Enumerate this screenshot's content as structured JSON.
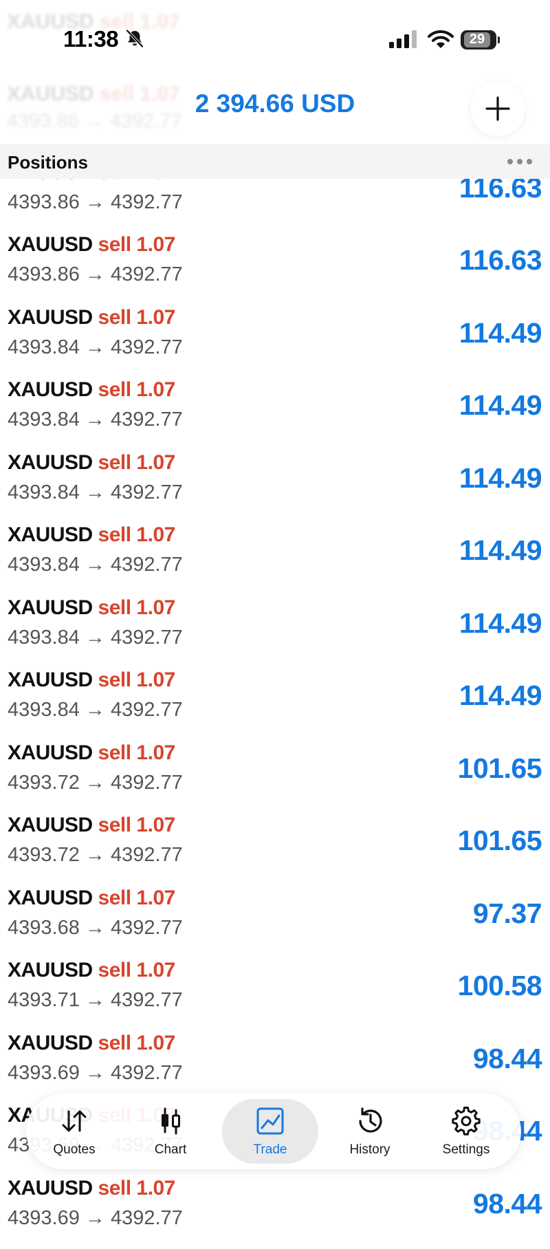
{
  "status_bar": {
    "time": "11:38",
    "battery": "29"
  },
  "header": {
    "balance": "2 394.66 USD",
    "section_title": "Positions"
  },
  "positions": [
    {
      "symbol": "XAUUSD",
      "side": "sell",
      "volume": "1.07",
      "open_price": "4393.86",
      "current_price": "4392.77",
      "profit": "116.63"
    },
    {
      "symbol": "XAUUSD",
      "side": "sell",
      "volume": "1.07",
      "open_price": "4393.86",
      "current_price": "4392.77",
      "profit": "116.63"
    },
    {
      "symbol": "XAUUSD",
      "side": "sell",
      "volume": "1.07",
      "open_price": "4393.84",
      "current_price": "4392.77",
      "profit": "114.49"
    },
    {
      "symbol": "XAUUSD",
      "side": "sell",
      "volume": "1.07",
      "open_price": "4393.84",
      "current_price": "4392.77",
      "profit": "114.49"
    },
    {
      "symbol": "XAUUSD",
      "side": "sell",
      "volume": "1.07",
      "open_price": "4393.84",
      "current_price": "4392.77",
      "profit": "114.49"
    },
    {
      "symbol": "XAUUSD",
      "side": "sell",
      "volume": "1.07",
      "open_price": "4393.84",
      "current_price": "4392.77",
      "profit": "114.49"
    },
    {
      "symbol": "XAUUSD",
      "side": "sell",
      "volume": "1.07",
      "open_price": "4393.84",
      "current_price": "4392.77",
      "profit": "114.49"
    },
    {
      "symbol": "XAUUSD",
      "side": "sell",
      "volume": "1.07",
      "open_price": "4393.84",
      "current_price": "4392.77",
      "profit": "114.49"
    },
    {
      "symbol": "XAUUSD",
      "side": "sell",
      "volume": "1.07",
      "open_price": "4393.72",
      "current_price": "4392.77",
      "profit": "101.65"
    },
    {
      "symbol": "XAUUSD",
      "side": "sell",
      "volume": "1.07",
      "open_price": "4393.72",
      "current_price": "4392.77",
      "profit": "101.65"
    },
    {
      "symbol": "XAUUSD",
      "side": "sell",
      "volume": "1.07",
      "open_price": "4393.68",
      "current_price": "4392.77",
      "profit": "97.37"
    },
    {
      "symbol": "XAUUSD",
      "side": "sell",
      "volume": "1.07",
      "open_price": "4393.71",
      "current_price": "4392.77",
      "profit": "100.58"
    },
    {
      "symbol": "XAUUSD",
      "side": "sell",
      "volume": "1.07",
      "open_price": "4393.69",
      "current_price": "4392.77",
      "profit": "98.44"
    }
  ],
  "tabs": [
    {
      "label": "Quotes",
      "icon": "quotes-arrows-icon",
      "active": false
    },
    {
      "label": "Chart",
      "icon": "candlestick-icon",
      "active": false
    },
    {
      "label": "Trade",
      "icon": "trade-chart-icon",
      "active": true
    },
    {
      "label": "History",
      "icon": "history-clock-icon",
      "active": false
    },
    {
      "label": "Settings",
      "icon": "gear-icon",
      "active": false
    }
  ],
  "colors": {
    "accent": "#1479e0",
    "sell": "#d8442d",
    "text": "#111111",
    "muted": "#555555"
  }
}
